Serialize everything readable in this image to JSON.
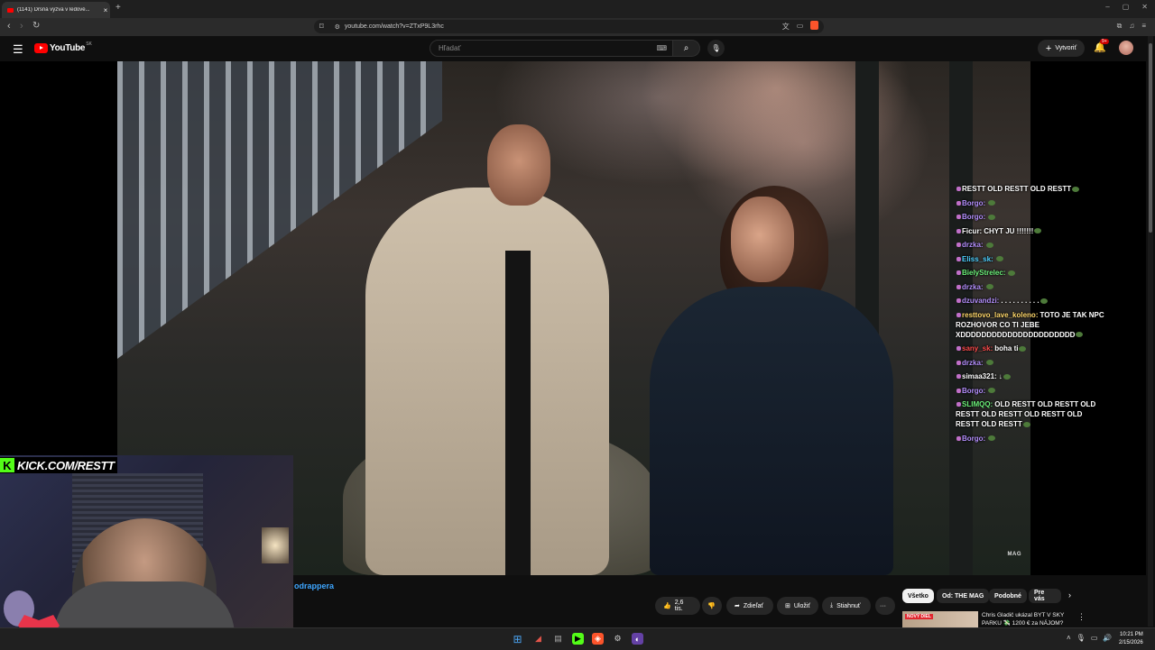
{
  "browser": {
    "tab_title": "(1141) Drsná výzva v ledové...",
    "tab_close": "×",
    "new_tab": "+",
    "url": "youtube.com/watch?v=ZTxP9L3rhc"
  },
  "youtube": {
    "logo_text": "YouTube",
    "region": "SK",
    "search_placeholder": "Hľadať",
    "create_label": "Vytvoriť",
    "notifications_badge": "9+"
  },
  "video": {
    "watermark": "MAG"
  },
  "overlay": {
    "kick_url": "KICK.COM/RESTT"
  },
  "chat": [
    {
      "user": "RESTT",
      "user_color": "#ffffff",
      "text": "OLD RESTT OLD RESTT"
    },
    {
      "user": "Borgo:",
      "user_color": "#b38ffc",
      "text": ""
    },
    {
      "user": "Borgo:",
      "user_color": "#b38ffc",
      "text": ""
    },
    {
      "user": "Ficur:",
      "user_color": "#ffffff",
      "text": "CHYT JU !!!!!!!"
    },
    {
      "user": "drzka:",
      "user_color": "#b38ffc",
      "text": ""
    },
    {
      "user": "Eliss_sk:",
      "user_color": "#4fd0ff",
      "text": ""
    },
    {
      "user": "BielyStrelec:",
      "user_color": "#6cf07a",
      "text": ""
    },
    {
      "user": "drzka:",
      "user_color": "#b38ffc",
      "text": ""
    },
    {
      "user": "dzuvandzi:",
      "user_color": "#b38ffc",
      "text": ". . . . . . . . . ."
    },
    {
      "user": "resttovo_lave_koleno:",
      "user_color": "#ffd86b",
      "text": "TOTO JE TAK NPC ROZHOVOR CO TI JEBE XDDDDDDDDDDDDDDDDDDDDDD"
    },
    {
      "user": "sany_sk:",
      "user_color": "#ff4d4d",
      "text": "boha ti"
    },
    {
      "user": "drzka:",
      "user_color": "#b38ffc",
      "text": ""
    },
    {
      "user": "simaa321:",
      "user_color": "#ffffff",
      "text": "↓"
    },
    {
      "user": "Borgo:",
      "user_color": "#b38ffc",
      "text": ""
    },
    {
      "user": "SLIMQQ:",
      "user_color": "#6cf07a",
      "text": "OLD RESTT OLD RESTT OLD RESTT OLD RESTT OLD RESTT OLD RESTT OLD RESTT"
    },
    {
      "user": "Borgo:",
      "user_color": "#b38ffc",
      "text": ""
    }
  ],
  "below_video": {
    "channel_name": "odrappera",
    "like_count": "2,6 tis.",
    "share_label": "Zdieľať",
    "save_label": "Uložiť",
    "download_label": "Stiahnuť",
    "more_label": "···"
  },
  "chips": [
    "Všetko",
    "Od: THE MAG",
    "Podobné",
    "Pre vás"
  ],
  "recommendation": {
    "badge": "NOVÝ DIEL",
    "title_line1": "Chris Gladič ukázal BYT V SKY",
    "title_line2": "PARKU 💸 1200 € za NÁJOM?"
  },
  "taskbar": {
    "time": "10:21 PM",
    "date": "2/15/2026"
  }
}
